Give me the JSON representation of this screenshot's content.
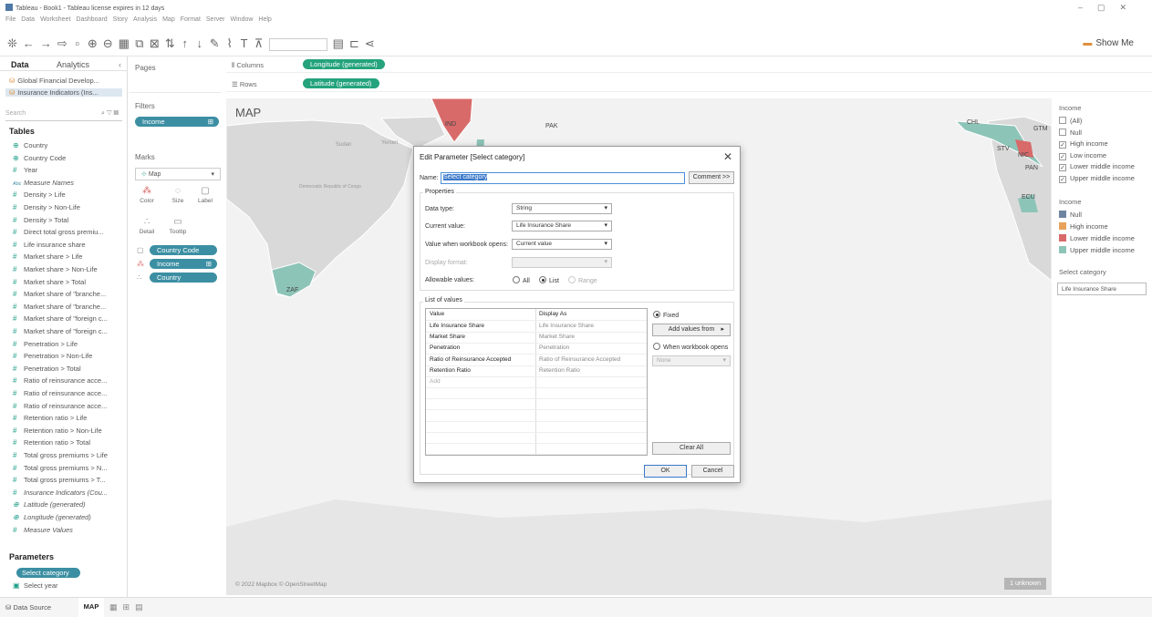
{
  "window": {
    "title": "Tableau - Book1 - Tableau license expires in 12 days",
    "controls": [
      "–",
      "▢",
      "✕"
    ]
  },
  "menu": [
    "File",
    "Data",
    "Worksheet",
    "Dashboard",
    "Story",
    "Analysis",
    "Map",
    "Format",
    "Server",
    "Window",
    "Help"
  ],
  "toolbar": {
    "show_me": "Show Me"
  },
  "left_pane": {
    "tab_data": "Data",
    "tab_analytics": "Analytics",
    "datasources": [
      "Global Financial Develop...",
      "Insurance Indicators (Ins..."
    ],
    "search_placeholder": "Search",
    "tables_heading": "Tables",
    "fields": [
      {
        "icon": "globe",
        "label": "Country"
      },
      {
        "icon": "globe",
        "label": "Country Code"
      },
      {
        "icon": "hash",
        "label": "Year"
      },
      {
        "icon": "abc",
        "label": "Measure Names",
        "italic": true
      },
      {
        "icon": "hash",
        "label": "Density > Life"
      },
      {
        "icon": "hash",
        "label": "Density > Non-Life"
      },
      {
        "icon": "hash",
        "label": "Density > Total"
      },
      {
        "icon": "hash",
        "label": "Direct total gross premiu..."
      },
      {
        "icon": "hash",
        "label": "Life insurance share"
      },
      {
        "icon": "hash",
        "label": "Market share > Life"
      },
      {
        "icon": "hash",
        "label": "Market share > Non-Life"
      },
      {
        "icon": "hash",
        "label": "Market share > Total"
      },
      {
        "icon": "hash",
        "label": "Market share of \"branche..."
      },
      {
        "icon": "hash",
        "label": "Market share of \"branche..."
      },
      {
        "icon": "hash",
        "label": "Market share of \"foreign c..."
      },
      {
        "icon": "hash",
        "label": "Market share of \"foreign c..."
      },
      {
        "icon": "hash",
        "label": "Penetration > Life"
      },
      {
        "icon": "hash",
        "label": "Penetration > Non-Life"
      },
      {
        "icon": "hash",
        "label": "Penetration > Total"
      },
      {
        "icon": "hash",
        "label": "Ratio of reinsurance acce..."
      },
      {
        "icon": "hash",
        "label": "Ratio of reinsurance acce..."
      },
      {
        "icon": "hash",
        "label": "Ratio of reinsurance acce..."
      },
      {
        "icon": "hash",
        "label": "Retention ratio > Life"
      },
      {
        "icon": "hash",
        "label": "Retention ratio > Non-Life"
      },
      {
        "icon": "hash",
        "label": "Retention ratio > Total"
      },
      {
        "icon": "hash",
        "label": "Total gross premiums > Life"
      },
      {
        "icon": "hash",
        "label": "Total gross premiums > N..."
      },
      {
        "icon": "hash",
        "label": "Total gross premiums > T..."
      },
      {
        "icon": "hash",
        "label": "Insurance Indicators (Cou...",
        "italic": true
      },
      {
        "icon": "globe",
        "label": "Latitude (generated)",
        "italic": true
      },
      {
        "icon": "globe",
        "label": "Longitude (generated)",
        "italic": true
      },
      {
        "icon": "hash",
        "label": "Measure Values",
        "italic": true
      }
    ],
    "parameters_heading": "Parameters",
    "parameters": [
      "Select category",
      "Select year"
    ]
  },
  "shelves": {
    "pages": "Pages",
    "filters": "Filters",
    "filter_pill": "Income",
    "marks": "Marks",
    "mark_type": "Map",
    "mark_buttons": [
      "Color",
      "Size",
      "Label",
      "Detail",
      "Tooltip"
    ],
    "mark_pills": [
      "Country Code",
      "Income",
      "Country"
    ],
    "columns_label": "Columns",
    "columns_pill": "Longitude (generated)",
    "rows_label": "Rows",
    "rows_pill": "Latitude (generated)"
  },
  "viz": {
    "title": "MAP",
    "attribution": "© 2022 Mapbox © OpenStreetMap",
    "unknown_badge": "1 unknown",
    "map_labels": [
      "IND",
      "PAK",
      "ZAF",
      "Sudan",
      "Yemen",
      "Democratic Republic of Congo",
      "CHL",
      "ECU",
      "PAN",
      "STV",
      "NIC",
      "GTM"
    ]
  },
  "legends": {
    "income_filter_title": "Income",
    "income_filter_items": [
      {
        "label": "(All)",
        "checked": false
      },
      {
        "label": "Null",
        "checked": false
      },
      {
        "label": "High income",
        "checked": true
      },
      {
        "label": "Low income",
        "checked": true
      },
      {
        "label": "Lower middle income",
        "checked": true
      },
      {
        "label": "Upper middle income",
        "checked": true
      }
    ],
    "income_color_title": "Income",
    "income_color_items": [
      {
        "label": "Null",
        "color": "#6f84a1"
      },
      {
        "label": "High income",
        "color": "#e8a25a"
      },
      {
        "label": "Lower middle income",
        "color": "#d86a6a"
      },
      {
        "label": "Upper middle income",
        "color": "#8dc4b8"
      }
    ],
    "select_category_title": "Select category",
    "select_category_value": "Life Insurance Share"
  },
  "bottom": {
    "data_source_tab": "Data Source",
    "sheet_tab": "MAP"
  },
  "dialog": {
    "title": "Edit Parameter [Select category]",
    "name_label": "Name:",
    "name_value": "Select category",
    "comment_button": "Comment >>",
    "properties_heading": "Properties",
    "data_type_label": "Data type:",
    "data_type_value": "String",
    "current_value_label": "Current value:",
    "current_value_value": "Life Insurance Share",
    "when_opens_label": "Value when workbook opens:",
    "when_opens_value": "Current value",
    "display_format_label": "Display format:",
    "allowable_label": "Allowable values:",
    "allowable_options": [
      "All",
      "List",
      "Range"
    ],
    "allowable_selected": "List",
    "lov_heading": "List of values",
    "lov_headers": [
      "Value",
      "Display As"
    ],
    "lov_rows": [
      [
        "Life Insurance Share",
        "Life Insurance Share"
      ],
      [
        "Market Share",
        "Market Share"
      ],
      [
        "Penetration",
        "Penetration"
      ],
      [
        "Ratio of Reinsurance Accepted",
        "Ratio of Reinsurance Accepted"
      ],
      [
        "Retention Ratio",
        "Retention Ratio"
      ]
    ],
    "lov_add": "Add",
    "fixed_label": "Fixed",
    "add_values_from": "Add values from",
    "when_workbook_opens": "When workbook opens",
    "none_value": "None",
    "clear_all": "Clear All",
    "ok": "OK",
    "cancel": "Cancel"
  }
}
